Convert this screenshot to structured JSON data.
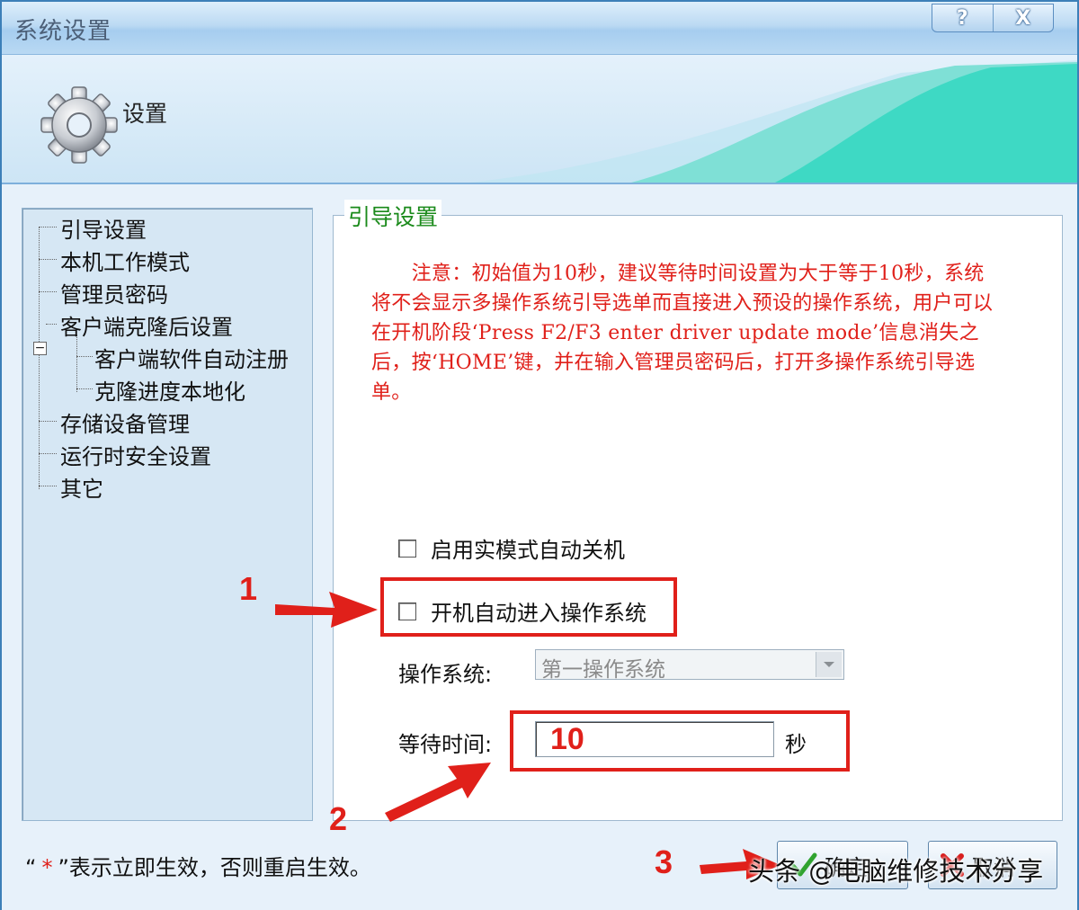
{
  "window": {
    "title": "系统设置",
    "help_button": "?",
    "close_button": "X"
  },
  "banner": {
    "title": "设置"
  },
  "tree": {
    "items": [
      {
        "label": "引导设置"
      },
      {
        "label": "本机工作模式"
      },
      {
        "label": "管理员密码"
      },
      {
        "label": "客户端克隆后设置"
      },
      {
        "label": "客户端软件自动注册"
      },
      {
        "label": "克隆进度本地化"
      },
      {
        "label": "存储设备管理"
      },
      {
        "label": "运行时安全设置"
      },
      {
        "label": "其它"
      }
    ],
    "expander": "−"
  },
  "group": {
    "title": "引导设置",
    "note": "　　注意：初始值为10秒，建议等待时间设置为大于等于10秒，系统将不会显示多操作系统引导选单而直接进入预设的操作系统，用户可以在开机阶段‘Press F2/F3 enter driver update mode’信息消失之后，按‘HOME’键，并在输入管理员密码后，打开多操作系统引导选单。",
    "checkbox_realmode": {
      "label": "启用实模式自动关机",
      "checked": false
    },
    "checkbox_autoboot": {
      "label": "开机自动进入操作系统",
      "checked": false
    },
    "os_label": "操作系统:",
    "os_value": "第一操作系统",
    "wait_label": "等待时间:",
    "wait_value": "10",
    "wait_unit": "秒"
  },
  "annotations": {
    "n1": "1",
    "n2": "2",
    "n3": "3"
  },
  "footer": {
    "note_open": "“",
    "note_star": "*",
    "note_rest": "”表示立即生效，否则重启生效。",
    "ok_label": "确定",
    "cancel_label": "取消"
  },
  "watermark": "头条 @电脑维修技术分享",
  "colors": {
    "accent_red": "#e0201a",
    "legend_green": "#1a8a1a",
    "title_blue": "#3c7fb8"
  }
}
